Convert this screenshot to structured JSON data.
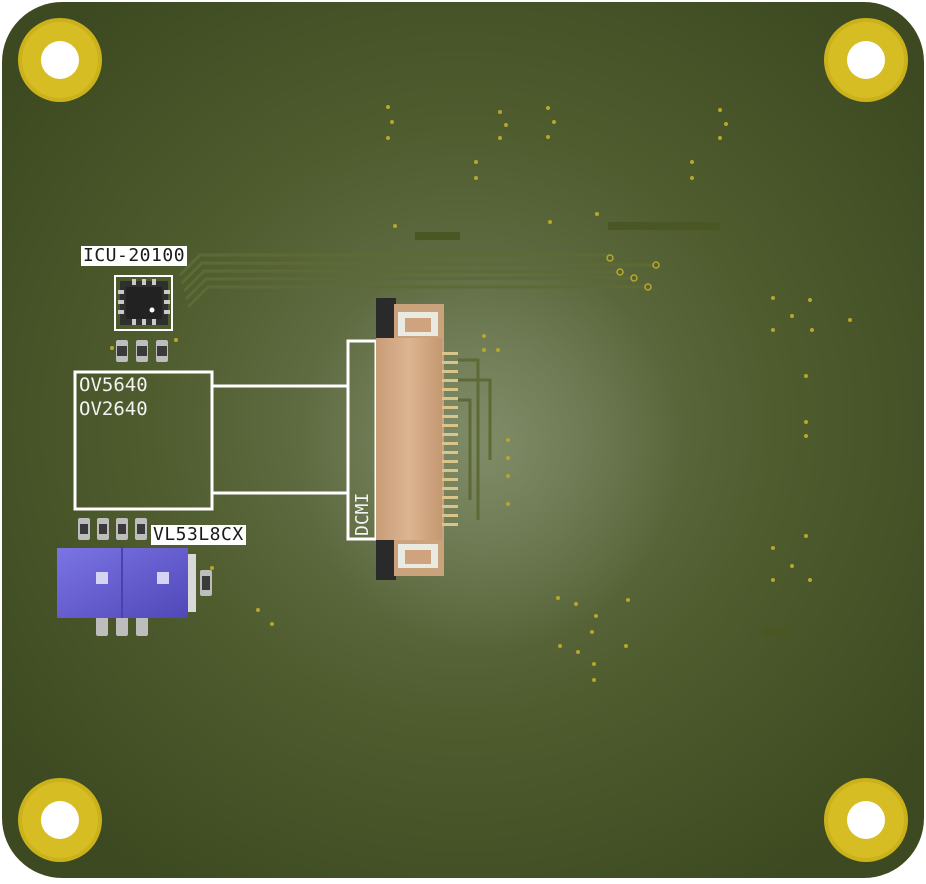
{
  "board": {
    "labels": {
      "imu": "ICU-20100",
      "camera_line1": "OV5640",
      "camera_line2": "OV2640",
      "tof": "VL53L8CX",
      "connector": "DCMI"
    },
    "colors": {
      "background": "#ffffff",
      "pcb_center": "#6e7a52",
      "pcb_edge": "#3d4a22",
      "silkscreen": "#ffffff",
      "pad_gold": "#c9b21a",
      "ffc_body": "#d4ab85",
      "ffc_latch": "#2a2a2a",
      "sensor_blue": "#6a62d6",
      "pin_silver": "#b9b9b9"
    }
  }
}
